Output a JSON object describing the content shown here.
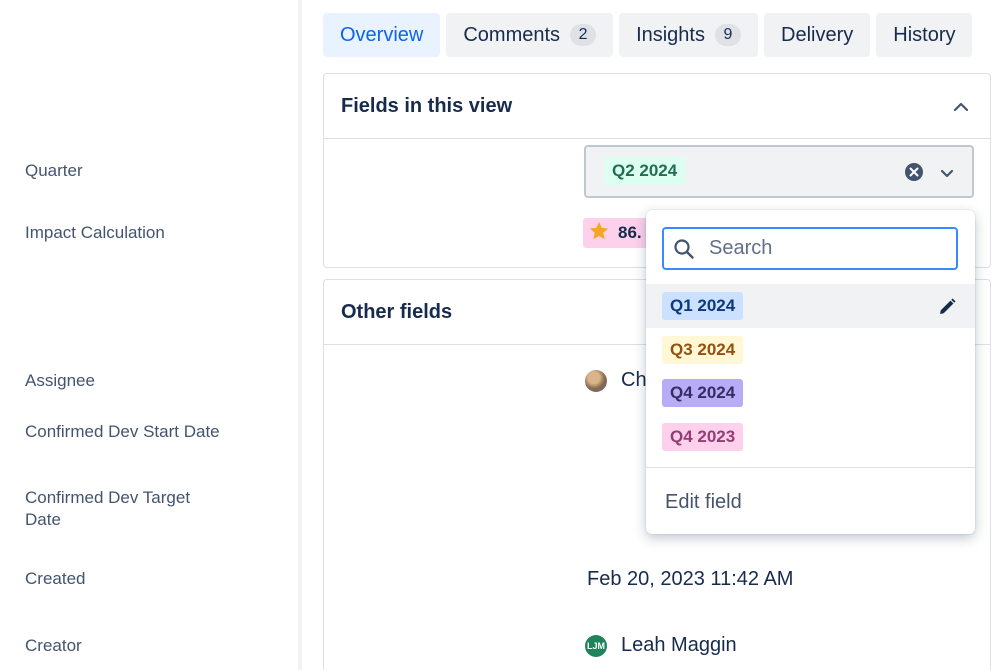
{
  "tabs": [
    {
      "label": "Overview",
      "count": null
    },
    {
      "label": "Comments",
      "count": "2"
    },
    {
      "label": "Insights",
      "count": "9"
    },
    {
      "label": "Delivery",
      "count": null
    },
    {
      "label": "History",
      "count": null
    }
  ],
  "fields_panel": {
    "title": "Fields in this view",
    "quarter": {
      "label": "Quarter",
      "value": "Q2 2024"
    },
    "impact": {
      "label": "Impact Calculation",
      "value": "86."
    }
  },
  "other_panel": {
    "title": "Other fields",
    "assignee": {
      "label": "Assignee",
      "value": "Ch"
    },
    "dev_start": {
      "label": "Confirmed Dev Start Date"
    },
    "dev_target": {
      "label": "Confirmed Dev Target Date"
    },
    "created": {
      "label": "Created",
      "value": "Feb 20, 2023 11:42 AM"
    },
    "creator": {
      "label": "Creator",
      "value": "Leah Maggin",
      "initials": "LJM"
    }
  },
  "dropdown": {
    "search_placeholder": "Search",
    "options": [
      "Q1 2024",
      "Q3 2024",
      "Q4 2024",
      "Q4 2023"
    ],
    "edit_label": "Edit field"
  },
  "colors": {
    "accent": "#0c66e4",
    "focus_border": "#388bff"
  },
  "icons": [
    "chevron-up-icon",
    "clear-icon",
    "chevron-down-icon",
    "star-icon",
    "search-icon",
    "pencil-icon"
  ]
}
